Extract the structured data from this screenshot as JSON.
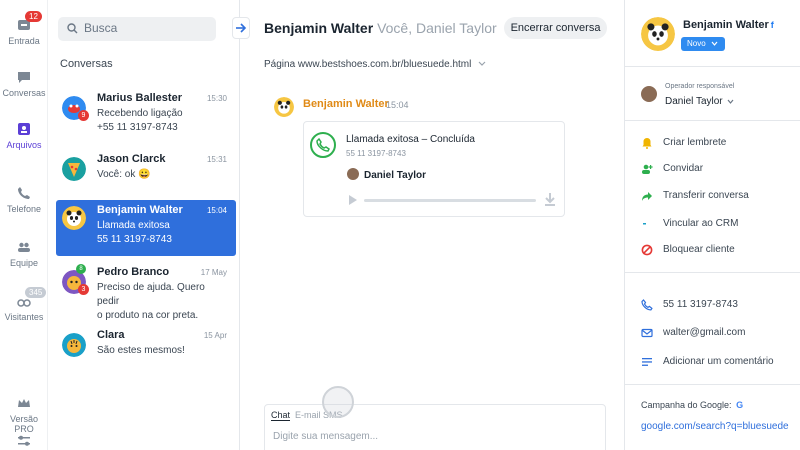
{
  "rail": {
    "items": [
      {
        "label": "Entrada",
        "badge": "12"
      },
      {
        "label": "Conversas"
      },
      {
        "label": "Arquivos"
      },
      {
        "label": "Telefone"
      },
      {
        "label": "Equipe"
      },
      {
        "label": "Visitantes",
        "badge": "345"
      }
    ],
    "version_label": "Versão PRO"
  },
  "search": {
    "placeholder": "Busca"
  },
  "conv_heading": "Conversas",
  "conversations": [
    {
      "name": "Marius Ballester",
      "time": "15:30",
      "line1": "Recebendo ligação",
      "line2": "+55 11 3197-8743",
      "badge": "9"
    },
    {
      "name": "Jason Clarck",
      "time": "15:31",
      "line1": "Você: ok 😀",
      "line2": ""
    },
    {
      "name": "Benjamin Walter",
      "time": "15:04",
      "line1": "Llamada exitosa",
      "line2": "55 11 3197-8743"
    },
    {
      "name": "Pedro Branco",
      "time": "17 May",
      "line1": "Preciso de ajuda. Quero pedir",
      "line2": "o produto na cor preta.",
      "badge": "3",
      "badge_top": "8"
    },
    {
      "name": "Clara",
      "time": "15 Apr",
      "line1": "São estes mesmos!",
      "line2": ""
    }
  ],
  "chat": {
    "title": "Benjamin Walter",
    "participants": "Você, Daniel Taylor",
    "end_button": "Encerrar conversa",
    "page_url": "Página www.bestshoes.com.br/bluesuede.html",
    "message": {
      "sender": "Benjamin Walter",
      "time": "15:04",
      "call_title": "Llamada exitosa – Concluída",
      "call_number": "55 11 3197-8743",
      "operator": "Daniel Taylor"
    },
    "composer": {
      "tabs": [
        "Chat",
        "E-mail",
        "SMS"
      ],
      "placeholder": "Digite sua mensagem..."
    }
  },
  "contact": {
    "name": "Benjamin Walter",
    "status": "Novo",
    "operator_label": "Operador responsável",
    "operator_name": "Daniel Taylor",
    "actions": [
      {
        "label": "Criar lembrete",
        "icon": "bell-icon",
        "color": "#f0b400"
      },
      {
        "label": "Convidar",
        "icon": "add-user-icon",
        "color": "#2eaf4e"
      },
      {
        "label": "Transferir conversa",
        "icon": "forward-icon",
        "color": "#2eaf4e"
      },
      {
        "label": "Vincular ao CRM",
        "icon": "link-icon",
        "color": "#1aa0c8"
      },
      {
        "label": "Bloquear cliente",
        "icon": "block-icon",
        "color": "#e53935"
      }
    ],
    "phone": "55 11 3197-8743",
    "email": "walter@gmail.com",
    "comment": "Adicionar um comentário",
    "campaign_label": "Campanha do Google:",
    "campaign_link": "google.com/search?q=bluesuede"
  }
}
